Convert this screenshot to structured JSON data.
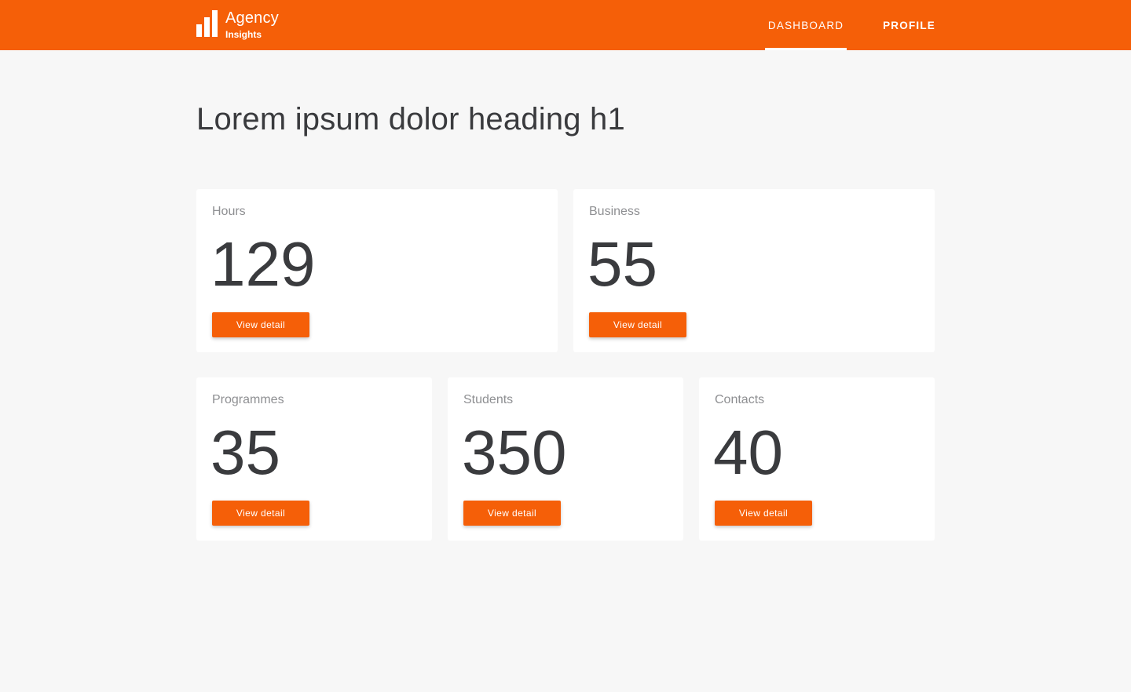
{
  "brand": {
    "title": "Agency",
    "subtitle": "Insights"
  },
  "nav": {
    "items": [
      {
        "label": "DASHBOARD"
      },
      {
        "label": "PROFILE"
      }
    ]
  },
  "heading": "Lorem ipsum dolor heading h1",
  "cards": [
    {
      "label": "Hours",
      "value": "129",
      "button": "View detail"
    },
    {
      "label": "Business",
      "value": "55",
      "button": "View detail"
    },
    {
      "label": "Programmes",
      "value": "35",
      "button": "View detail"
    },
    {
      "label": "Students",
      "value": "350",
      "button": "View detail"
    },
    {
      "label": "Contacts",
      "value": "40",
      "button": "View detail"
    }
  ],
  "colors": {
    "accent": "#f55f08",
    "background": "#f7f7f7",
    "card": "#ffffff",
    "text": "#3a3b3e",
    "muted": "#8e8f92"
  }
}
